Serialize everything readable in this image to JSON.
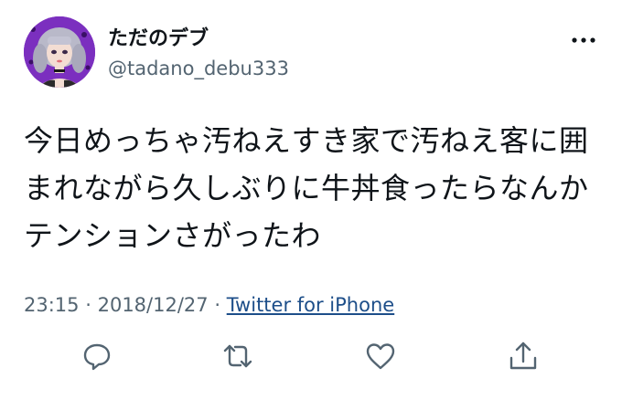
{
  "user": {
    "display_name": "ただのデブ",
    "handle": "@tadano_debu333",
    "avatar_icon": "avatar-anime-girl"
  },
  "tweet": {
    "lines": [
      "今日めっちゃ汚ねえすき家で汚ねえ客に囲",
      "まれながら久しぶりに牛丼食ったらなんか",
      "テンションさがったわ"
    ],
    "time": "23:15",
    "date": "2018/12/27",
    "separator": "·",
    "source": "Twitter for iPhone"
  },
  "actions": {
    "reply_icon": "reply-icon",
    "retweet_icon": "retweet-icon",
    "like_icon": "heart-icon",
    "share_icon": "share-icon",
    "more_icon": "more-icon"
  },
  "colors": {
    "text": "#0f1419",
    "secondary": "#536471",
    "link": "#1d4e89",
    "avatar_bg": "#7b2fbf"
  }
}
